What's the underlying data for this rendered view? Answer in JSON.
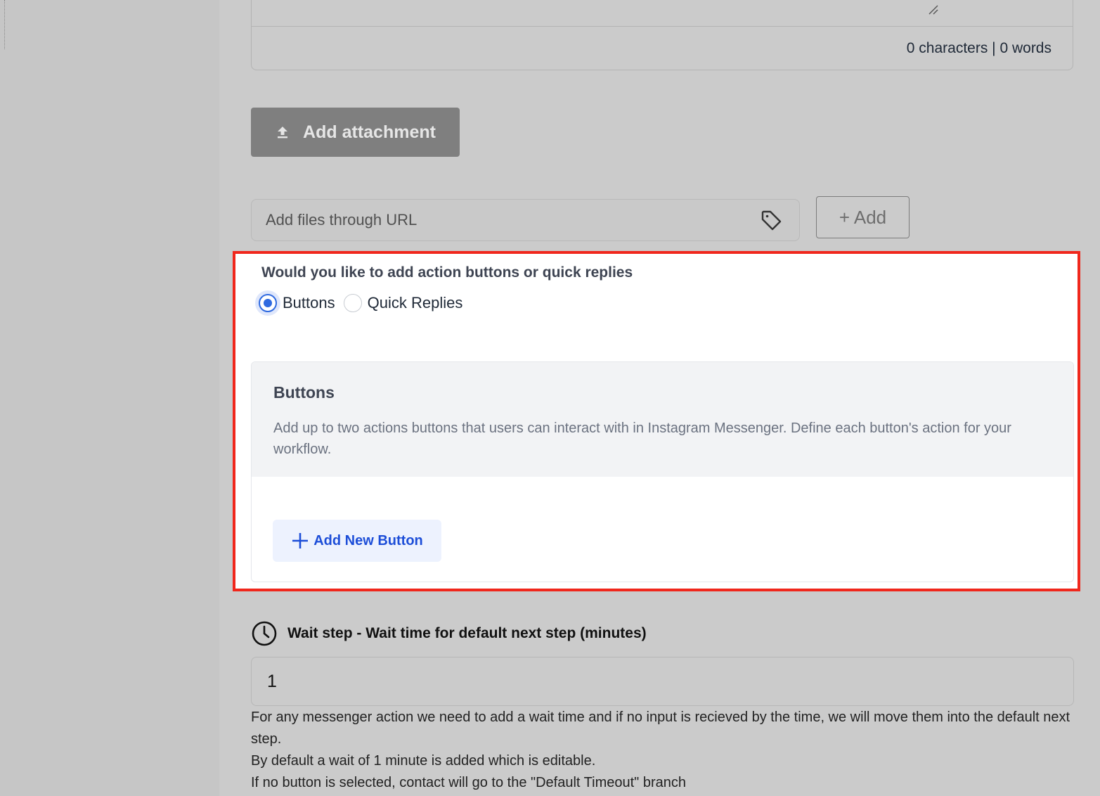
{
  "editor": {
    "counter": "0 characters | 0 words"
  },
  "attachment": {
    "button_label": "Add attachment",
    "icon": "upload-icon"
  },
  "url_input": {
    "placeholder": "Add files through URL",
    "icon": "tag-icon",
    "add_button": "+ Add"
  },
  "action_choice": {
    "question": "Would you like to add action buttons or quick replies",
    "options": [
      {
        "label": "Buttons",
        "selected": true
      },
      {
        "label": "Quick Replies",
        "selected": false
      }
    ]
  },
  "buttons_card": {
    "title": "Buttons",
    "description": "Add up to two actions buttons that users can interact with in Instagram Messenger. Define each button's action for your workflow.",
    "add_button": "Add New Button"
  },
  "wait_step": {
    "title": "Wait step - Wait time for default next step (minutes)",
    "value": "1",
    "help": [
      "For any messenger action we need to add a wait time and if no input is recieved by the time, we will move them into the default next step.",
      "By default a wait of 1 minute is added which is editable.",
      "If no button is selected, contact will go to the \"Default Timeout\" branch"
    ]
  },
  "colors": {
    "highlight_border": "#f0271c",
    "accent_blue": "#2f6ae0",
    "link_blue": "#1d4ed8"
  }
}
